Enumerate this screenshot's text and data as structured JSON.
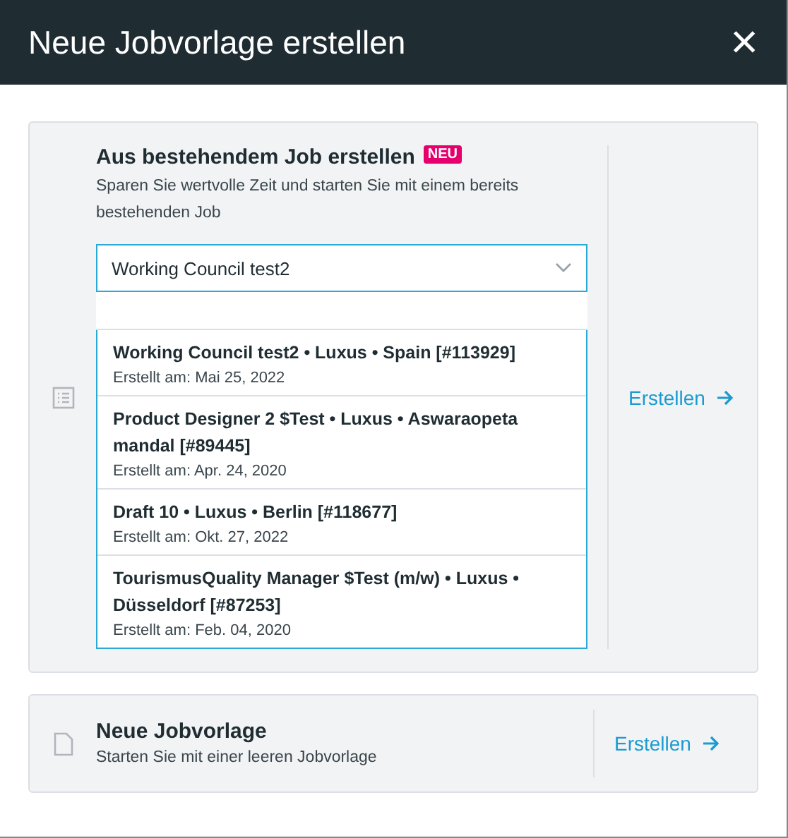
{
  "dialog": {
    "title": "Neue Jobvorlage erstellen",
    "close": "×"
  },
  "from_existing": {
    "title": "Aus bestehendem Job erstellen",
    "badge": "NEU",
    "description": "Sparen Sie wertvolle Zeit und starten Sie mit einem bereits bestehenden Job",
    "select": {
      "value": "Working Council test2",
      "expanded": true
    },
    "options": [
      {
        "title": "Working Council test2 • Luxus • Spain [#113929]",
        "date": "Erstellt am: Mai 25, 2022"
      },
      {
        "title": "Product Designer 2 $Test • Luxus • Aswaraopeta mandal [#89445]",
        "date": "Erstellt am: Apr. 24, 2020"
      },
      {
        "title": "Draft 10 • Luxus • Berlin [#118677]",
        "date": "Erstellt am: Okt. 27, 2022"
      },
      {
        "title": "TourismusQuality Manager $Test (m/w) • Luxus • Düsseldorf [#87253]",
        "date": "Erstellt am: Feb. 04, 2020"
      }
    ],
    "action": "Erstellen"
  },
  "blank": {
    "title": "Neue Jobvorlage",
    "description": "Starten Sie mit einer leeren Jobvorlage",
    "action": "Erstellen"
  }
}
